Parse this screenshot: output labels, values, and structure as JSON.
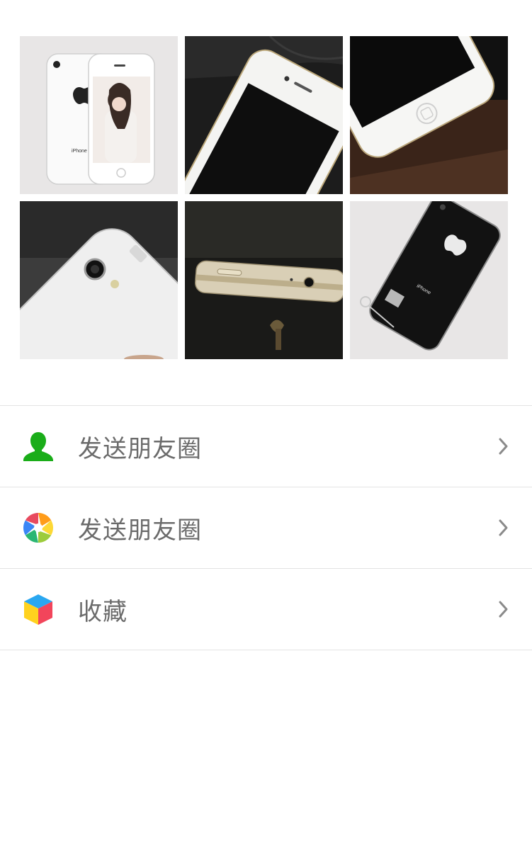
{
  "photos": [
    {
      "name": "photo-1",
      "subject": "white phone front and back",
      "bg": "#e8e6e6"
    },
    {
      "name": "photo-2",
      "subject": "white phone on black leather",
      "bg": "#1d1d1d"
    },
    {
      "name": "photo-3",
      "subject": "white phone home button on brown leather",
      "bg": "#3a2419"
    },
    {
      "name": "photo-4",
      "subject": "white phone back camera",
      "bg": "#3a3a3a"
    },
    {
      "name": "photo-5",
      "subject": "gold phone side edge",
      "bg": "#1a1a18"
    },
    {
      "name": "photo-6",
      "subject": "black phone back with sim tool",
      "bg": "#e8e6e6"
    }
  ],
  "photo_texts": {
    "iphone_label_1": "iPhone",
    "iphone_label_6": "iPhone"
  },
  "menu": {
    "items": [
      {
        "label": "发送朋友圈",
        "icon": "contact-person-icon",
        "color": "#1aad19"
      },
      {
        "label": "发送朋友圈",
        "icon": "moments-aperture-icon",
        "color": "multicolor"
      },
      {
        "label": "收藏",
        "icon": "favorites-cube-icon",
        "color": "multicolor"
      }
    ]
  }
}
